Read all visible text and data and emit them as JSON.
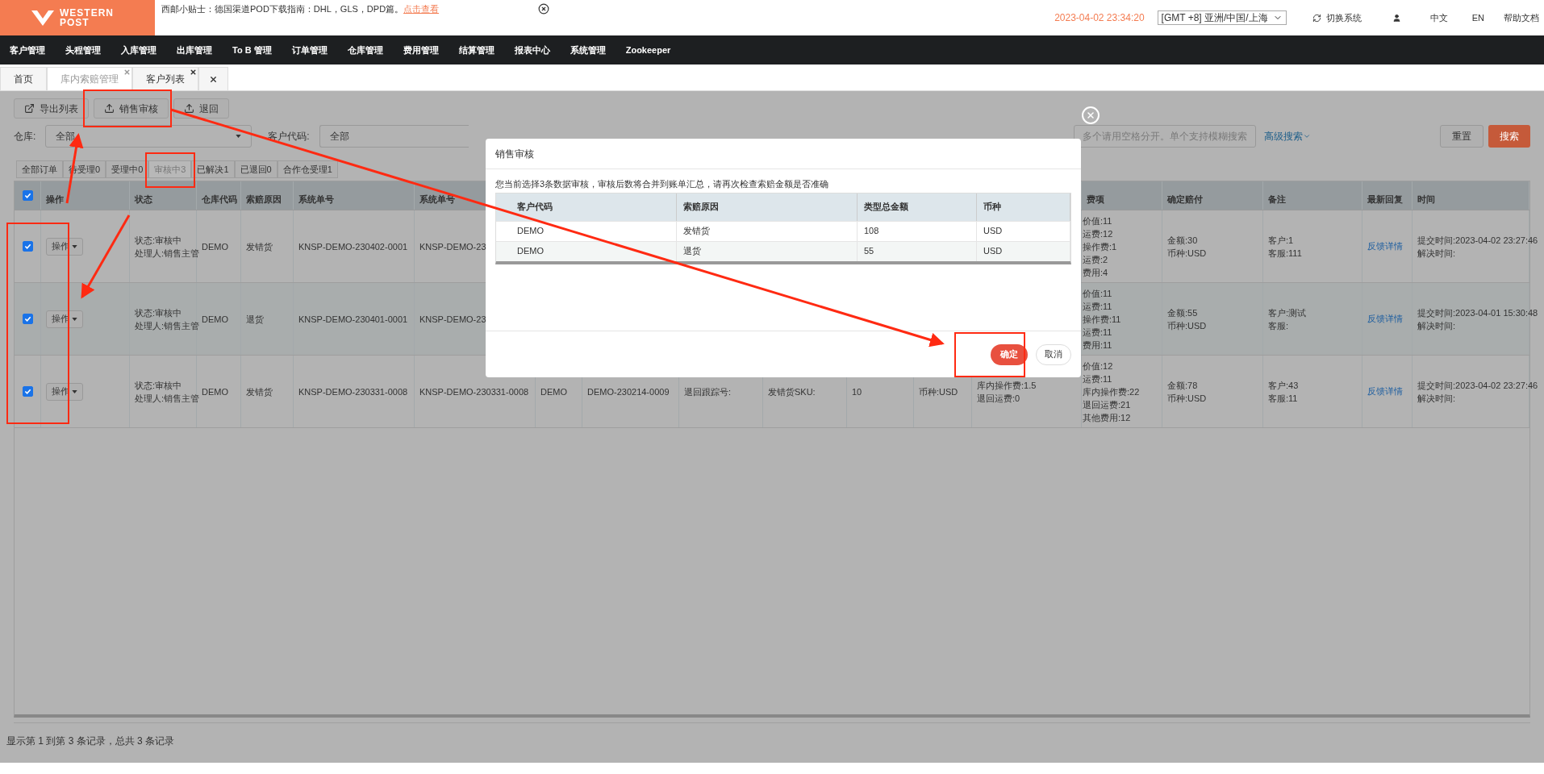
{
  "header": {
    "logo": [
      "WESTERN",
      "POST"
    ],
    "tip": "西邮小贴士：德国渠道POD下载指南：DHL，GLS，DPD篇。",
    "tip_link": "点击查看",
    "datetime": "2023-04-02 23:34:20",
    "timezone": "[GMT +8] 亚洲/中国/上海",
    "switch_system": "切换系统",
    "languages": [
      "中文",
      "EN"
    ],
    "help": "帮助文档"
  },
  "nav": [
    "客户管理",
    "头程管理",
    "入库管理",
    "出库管理",
    "To B 管理",
    "订单管理",
    "仓库管理",
    "费用管理",
    "结算管理",
    "报表中心",
    "系统管理",
    "Zookeeper"
  ],
  "page_tabs": [
    {
      "kind": "page",
      "label": "首页",
      "selected": false,
      "closable": false
    },
    {
      "kind": "page",
      "label": "库内索赔管理",
      "selected": true,
      "closable": true
    },
    {
      "kind": "page",
      "label": "客户列表",
      "selected": false,
      "closable": true
    },
    {
      "kind": "close",
      "selected": false
    }
  ],
  "toolbar": [
    {
      "kind": "export",
      "label": "导出列表"
    },
    {
      "kind": "upload",
      "label": "销售审核"
    },
    {
      "kind": "upload",
      "label": "退回"
    }
  ],
  "filters": {
    "warehouse_label": "仓库:",
    "warehouse": "全部",
    "customer_label": "客户代码:",
    "customer": "全部",
    "product_placeholder": "多个请用空格分开。单个支持模糊搜索",
    "advanced": "高级搜索",
    "reset": "重置",
    "search": "搜索"
  },
  "status_tabs": [
    {
      "label": "全部订单",
      "selected": false
    },
    {
      "label": "待受理0",
      "selected": false
    },
    {
      "label": "受理中0",
      "selected": false
    },
    {
      "label": "审核中3",
      "selected": true
    },
    {
      "label": "已解决1",
      "selected": false
    },
    {
      "label": "已退回0",
      "selected": false
    },
    {
      "label": "合作仓受理1",
      "selected": false
    }
  ],
  "table": {
    "all_checked": true,
    "columns": [
      "操作",
      "状态",
      "仓库代码",
      "索赔原因",
      "系统单号",
      "系统单号",
      "费项",
      "确定赔付",
      "备注",
      "最新回复",
      "时间"
    ],
    "rows": [
      {
        "checked": true,
        "action": "操作",
        "status": [
          "状态:审核中",
          "处理人:销售主管"
        ],
        "warehouse": "DEMO",
        "reason": "发错货",
        "system_no": "KNSP-DEMO-230402-0001",
        "system_no_2": "KNSP-DEMO-23",
        "fees": [
          "价值:11",
          "运费:12",
          "操作费:1",
          "运费:2",
          "费用:4"
        ],
        "payout": [
          "金额:30",
          "币种:USD"
        ],
        "remarks": [
          "客户:1",
          "客服:111"
        ],
        "reply": "反馈详情",
        "times": [
          "提交时间:2023-04-02 23:27:46",
          "解决时间:"
        ]
      },
      {
        "checked": true,
        "action": "操作",
        "status": [
          "状态:审核中",
          "处理人:销售主管"
        ],
        "warehouse": "DEMO",
        "reason": "退货",
        "system_no": "KNSP-DEMO-230401-0001",
        "system_no_2": "KNSP-DEMO-23",
        "fees": [
          "价值:11",
          "运费:11",
          "操作费:11",
          "运费:11",
          "费用:11"
        ],
        "payout": [
          "金额:55",
          "币种:USD"
        ],
        "remarks": [
          "客户:测试",
          "客服:"
        ],
        "reply": "反馈详情",
        "times": [
          "提交时间:2023-04-01 15:30:48",
          "解决时间:"
        ]
      },
      {
        "checked": true,
        "action": "操作",
        "status": [
          "状态:审核中",
          "处理人:销售主管"
        ],
        "warehouse": "DEMO",
        "reason": "发错货",
        "system_no": "KNSP-DEMO-230331-0008",
        "system_no_2": "KNSP-DEMO-230331-0008",
        "extra_cells": [
          [
            "DEMO"
          ],
          [
            "DEMO-230214-0009"
          ],
          [
            "退回跟踪号:"
          ],
          [
            "发错货SKU:"
          ],
          [
            "10"
          ],
          [
            "币种:USD"
          ],
          [
            "库内操作费:1.5",
            "退回运费:0"
          ]
        ],
        "fees": [
          "价值:12",
          "运费:11",
          "库内操作费:22",
          "退回运费:21",
          "其他费用:12"
        ],
        "payout": [
          "金额:78",
          "币种:USD"
        ],
        "remarks": [
          "客户:43",
          "客服:11"
        ],
        "reply": "反馈详情",
        "times": [
          "提交时间:2023-04-02 23:27:46",
          "解决时间:"
        ]
      }
    ]
  },
  "footer": "显示第 1 到第 3 条记录，总共 3 条记录",
  "dialog": {
    "title": "销售审核",
    "message": "您当前选择3条数据审核，审核后数将合并到账单汇总，请再次检查索赔金额是否准确",
    "columns": [
      "客户代码",
      "索赔原因",
      "类型总金额",
      "币种"
    ],
    "rows": [
      [
        "DEMO",
        "发错货",
        "108",
        "USD"
      ],
      [
        "DEMO",
        "退货",
        "55",
        "USD"
      ]
    ],
    "confirm": "确定",
    "cancel": "取消"
  }
}
